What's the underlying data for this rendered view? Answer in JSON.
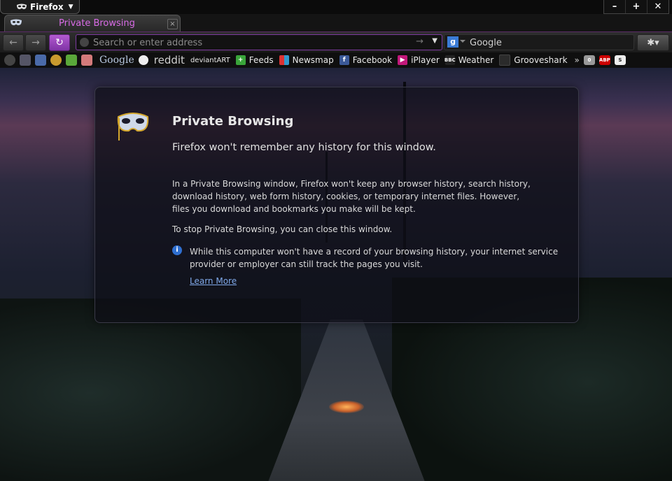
{
  "window": {
    "app_button": "Firefox",
    "controls": [
      "–",
      "+",
      "✕"
    ]
  },
  "tab": {
    "title": "Private Browsing",
    "close": "×"
  },
  "newtab": "⊕",
  "navbar": {
    "back": "←",
    "forward": "→",
    "reload": "↻",
    "url_placeholder": "Search or enter address",
    "go": "→",
    "url_drop": "▼",
    "search_engine_icon": "g",
    "search_placeholder": "Google",
    "menu": "✱▾"
  },
  "bookmarks": {
    "google": "Google",
    "reddit": "reddit",
    "deviantart": "deviantART",
    "feeds": "Feeds",
    "newsmap": "Newsmap",
    "facebook": "Facebook",
    "iplayer": "iPlayer",
    "weather": "Weather",
    "grooveshark": "Grooveshark",
    "overflow": "»",
    "ext_badges": [
      "0",
      "ABP",
      "S"
    ]
  },
  "panel": {
    "title": "Private Browsing",
    "subtitle": "Firefox won't remember any history for this window.",
    "body": "In a Private Browsing window, Firefox won't keep any browser history, search history, download history, web form history, cookies, or temporary internet files. However, files you download and bookmarks you make will be kept.",
    "stop": "To stop Private Browsing, you can close this window.",
    "info_icon": "i",
    "note": "While this computer won't have a record of your browsing history, your internet service provider or employer can still track the pages you visit.",
    "learn_more": "Learn More"
  }
}
